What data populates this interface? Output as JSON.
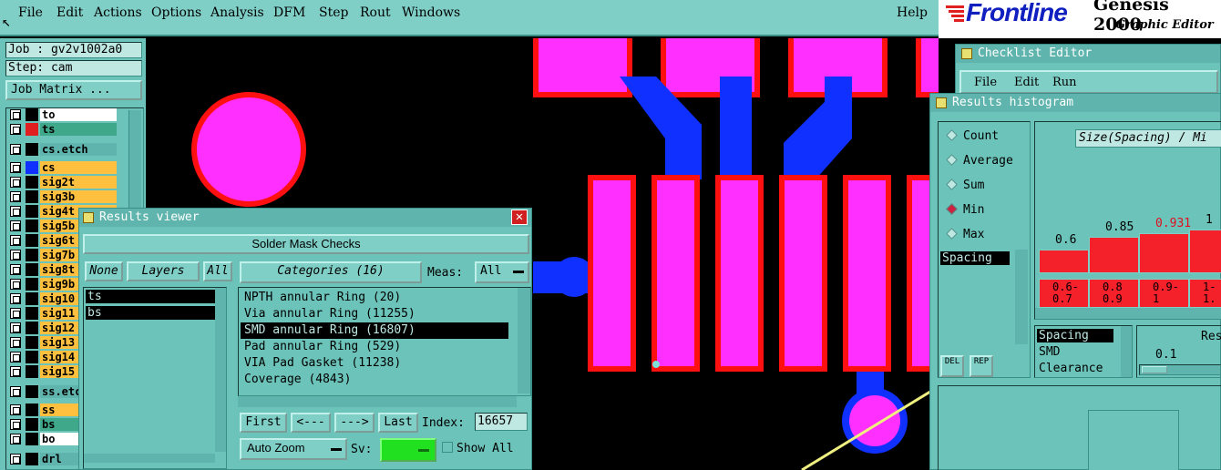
{
  "menubar": {
    "items": [
      "File",
      "Edit",
      "Actions",
      "Options",
      "Analysis",
      "DFM",
      "Step",
      "Rout",
      "Windows"
    ],
    "help": "Help"
  },
  "logo": {
    "brand": "Frontline",
    "product": "Genesis 2000",
    "subtitle": "Graphic Editor"
  },
  "job": {
    "job_label": "Job : gv2v1002a0",
    "step_label": "Step: cam",
    "matrix_button": "Job Matrix ..."
  },
  "layers": [
    {
      "name": "to",
      "color": "#ffffff"
    },
    {
      "name": "ts",
      "color": "#3fa88a"
    },
    {
      "name": "cs.etch",
      "color": "#5fb5ad"
    },
    {
      "name": "cs",
      "color": "#ffc040"
    },
    {
      "name": "sig2t",
      "color": "#ffc040"
    },
    {
      "name": "sig3b",
      "color": "#ffc040"
    },
    {
      "name": "sig4t",
      "color": "#ffc040"
    },
    {
      "name": "sig5b",
      "color": "#ffc040"
    },
    {
      "name": "sig6t",
      "color": "#ffc040"
    },
    {
      "name": "sig7b",
      "color": "#ffc040"
    },
    {
      "name": "sig8t",
      "color": "#ffc040"
    },
    {
      "name": "sig9b",
      "color": "#ffc040"
    },
    {
      "name": "sig10",
      "color": "#ffc040"
    },
    {
      "name": "sig11",
      "color": "#ffc040"
    },
    {
      "name": "sig12",
      "color": "#ffc040"
    },
    {
      "name": "sig13",
      "color": "#ffc040"
    },
    {
      "name": "sig14",
      "color": "#ffc040"
    },
    {
      "name": "sig15",
      "color": "#ffc040"
    },
    {
      "name": "ss.etch",
      "color": "#5fb5ad"
    },
    {
      "name": "ss",
      "color": "#ffc040"
    },
    {
      "name": "bs",
      "color": "#3fa88a"
    },
    {
      "name": "bo",
      "color": "#ffffff"
    },
    {
      "name": "drl",
      "color": "#5fb5ad"
    }
  ],
  "results_viewer": {
    "title": "Results viewer",
    "header": "Solder Mask Checks",
    "none_btn": "None",
    "layers_btn": "Layers",
    "all_btn": "All",
    "layer_list": [
      "ts",
      "bs"
    ],
    "categories_btn": "Categories (16)",
    "meas_label": "Meas:",
    "meas_value": "All",
    "categories": [
      "NPTH annular Ring (20)",
      "Via annular Ring (11255)",
      "SMD annular Ring (16807)",
      "Pad annular Ring (529)",
      "VIA Pad Gasket (11238)",
      "Coverage (4843)"
    ],
    "selected_index": 2,
    "first": "First",
    "prev": "<---",
    "next": "--->",
    "last": "Last",
    "index_label": "Index:",
    "index_value": "16657",
    "auto_zoom": "Auto Zoom",
    "sv_label": "Sv:",
    "show_all": "Show All"
  },
  "checklist_editor": {
    "title": "Checklist Editor",
    "menu": [
      "File",
      "Edit",
      "Run"
    ]
  },
  "histogram": {
    "title": "Results histogram",
    "options": [
      "Count",
      "Average",
      "Sum",
      "Min",
      "Max"
    ],
    "selected_option": "Min",
    "list_item": "Spacing",
    "chart_title": "Size(Spacing) / Mi",
    "bar_values": [
      "0.6",
      "0.85",
      "0.931",
      "1"
    ],
    "bar_ranges": [
      [
        "0.6-",
        "0.7"
      ],
      [
        "0.8",
        "0.9"
      ],
      [
        "0.9-",
        "1"
      ],
      [
        "1-",
        "1."
      ]
    ],
    "bar_heights": [
      0.6,
      0.85,
      0.931,
      1
    ],
    "type_list": [
      "Spacing",
      "SMD",
      "Clearance"
    ],
    "res_label": "Res",
    "threshold": "0.1",
    "del_btn": "DEL",
    "rep_btn": "REP"
  },
  "colors": {
    "pad": "#ff30ff",
    "outline": "#ff1010",
    "trace": "#1030ff",
    "panel": "#6cc3b9",
    "menubar": "#7fcfc7"
  }
}
